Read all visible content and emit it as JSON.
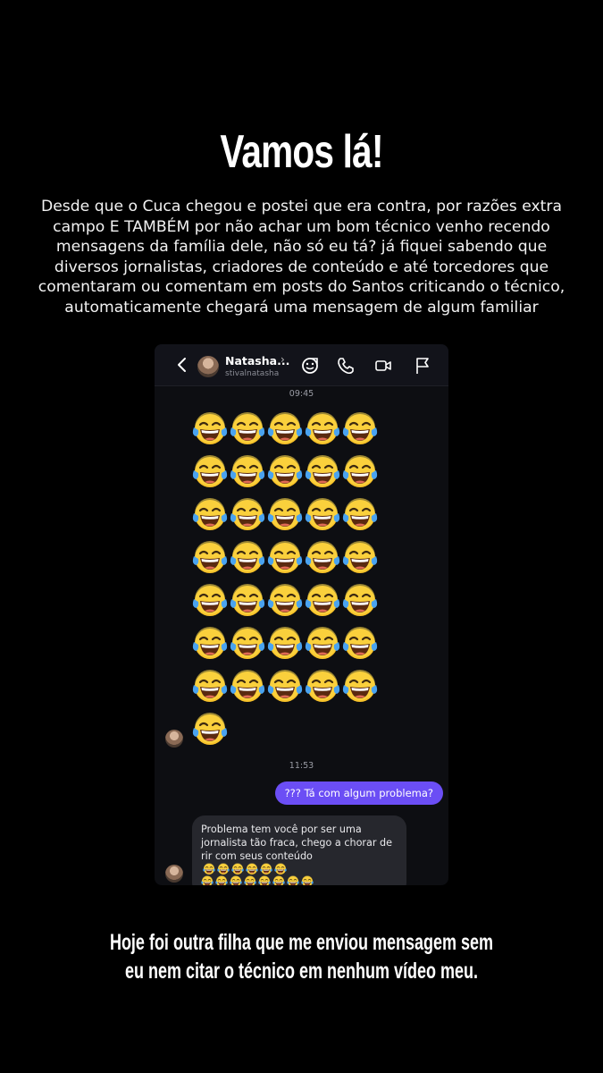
{
  "title": "Vamos lá!",
  "intro": "Desde que o Cuca chegou e postei que era contra, por razões extra campo E TAMBÉM por não achar um bom técnico venho recendo mensagens da família dele, não só eu tá? já fiquei sabendo que diversos jornalistas, criadores de conteúdo e até torcedores que comentaram ou comentam em posts do Santos criticando o técnico, automaticamente chegará uma mensagem de algum familiar",
  "chat": {
    "contact_name": "Natasha...",
    "contact_username": "stivalnatasha",
    "icons": [
      "back-arrow-icon",
      "sticker-icon",
      "phone-icon",
      "video-icon",
      "flag-icon"
    ],
    "time_1": "09:45",
    "emoji_message": {
      "emoji": "😂",
      "count": 36
    },
    "time_2": "11:53",
    "sent_message": "??? Tá com algum problema?",
    "received_message": "Problema tem você por ser uma jornalista tão fraca, chego a chorar de rir com seus conteúdo 😂😂😂😂😂😂😂😂😂😂😂😂😂😂"
  },
  "footer": {
    "line1": "Hoje foi outra filha que me enviou mensagem sem",
    "line2": "eu nem citar o técnico em nenhum vídeo meu."
  },
  "colors": {
    "background": "#000000",
    "sent_bubble": "#6b4ef5",
    "received_bubble": "#26272d",
    "emoji_face": "#f8c52a"
  }
}
